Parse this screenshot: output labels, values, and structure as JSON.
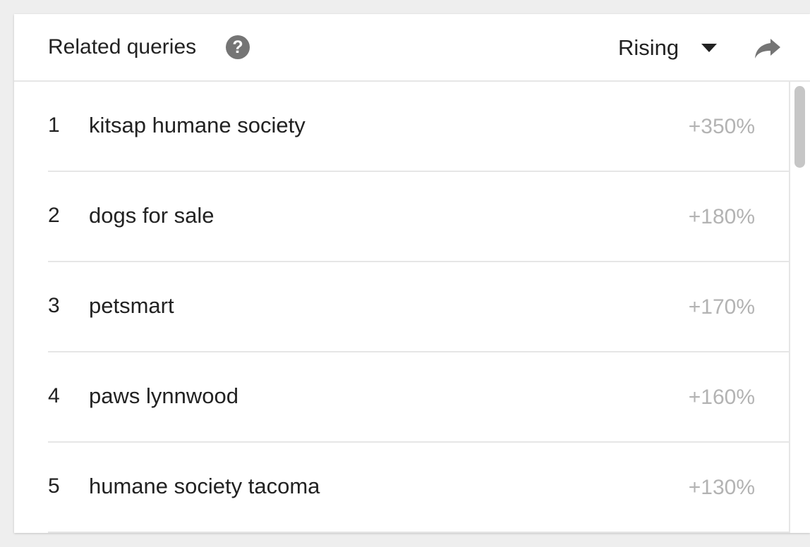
{
  "header": {
    "title": "Related queries",
    "help_icon_glyph": "?",
    "help_icon": "question-circle-icon",
    "filter_label": "Rising",
    "dropdown_icon": "caret-down-icon",
    "share_icon": "share-arrow-icon"
  },
  "queries": [
    {
      "rank": "1",
      "query": "kitsap humane society",
      "change": "+350%"
    },
    {
      "rank": "2",
      "query": "dogs for sale",
      "change": "+180%"
    },
    {
      "rank": "3",
      "query": "petsmart",
      "change": "+170%"
    },
    {
      "rank": "4",
      "query": "paws lynnwood",
      "change": "+160%"
    },
    {
      "rank": "5",
      "query": "humane society tacoma",
      "change": "+130%"
    }
  ],
  "colors": {
    "background": "#eeeeee",
    "card": "#ffffff",
    "text": "#222222",
    "muted_value": "#b3b3b3",
    "icon": "#757575",
    "divider": "#e6e6e6"
  }
}
